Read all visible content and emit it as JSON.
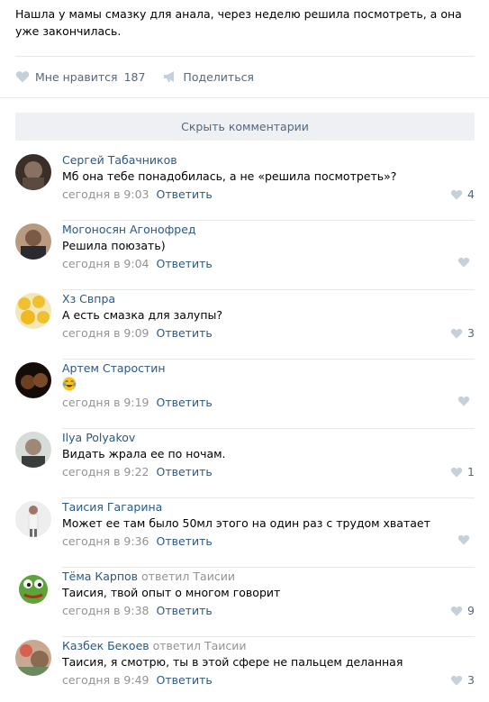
{
  "post": {
    "text": "Нашла у мамы смазку для анала, через неделю решила посмотреть, а она уже закончилась."
  },
  "actions": {
    "like_label": "Мне нравится",
    "like_count": "187",
    "share_label": "Поделиться"
  },
  "hide_comments_label": "Скрыть комментарии",
  "comments": [
    {
      "author": "Сергей Табачников",
      "text": "Мб она тебе понадобилась, а не «решила посмотреть»?",
      "time": "сегодня в 9:03",
      "reply_label": "Ответить",
      "likes": "4"
    },
    {
      "author": "Могоносян Агонофред",
      "text": "Решила поюзать)",
      "time": "сегодня в 9:04",
      "reply_label": "Ответить",
      "likes": ""
    },
    {
      "author": "Хз Свпра",
      "text": "А есть смазка для залупы?",
      "time": "сегодня в 9:09",
      "reply_label": "Ответить",
      "likes": "3"
    },
    {
      "author": "Артем Старостин",
      "text": "",
      "emoji": "laughing-tears-emoji",
      "time": "сегодня в 9:19",
      "reply_label": "Ответить",
      "likes": ""
    },
    {
      "author": "Ilya Polyakov",
      "text": "Видать жрала ее по ночам.",
      "time": "сегодня в 9:22",
      "reply_label": "Ответить",
      "likes": "1"
    },
    {
      "author": "Таисия Гагарина",
      "text": "Может ее там было 50мл этого на один раз с трудом хватает",
      "time": "сегодня в 9:36",
      "reply_label": "Ответить",
      "likes": ""
    },
    {
      "author": "Тёма Карпов",
      "replied_word": "ответил",
      "replied_to": "Таисии",
      "text": "Таисия, твой опыт о многом говорит",
      "time": "сегодня в 9:38",
      "reply_label": "Ответить",
      "likes": "9"
    },
    {
      "author": "Казбек Бекоев",
      "replied_word": "ответил",
      "replied_to": "Таисии",
      "text": "Таисия, я смотрю, ты в этой сфере не пальцем деланная",
      "time": "сегодня в 9:49",
      "reply_label": "Ответить",
      "likes": "3"
    }
  ],
  "colors": {
    "link": "#2a5885",
    "meta": "#939393",
    "action": "#55677d",
    "button_bg": "#eef0f3",
    "icon": "#c5d0db",
    "separator": "#e7e8ec"
  }
}
